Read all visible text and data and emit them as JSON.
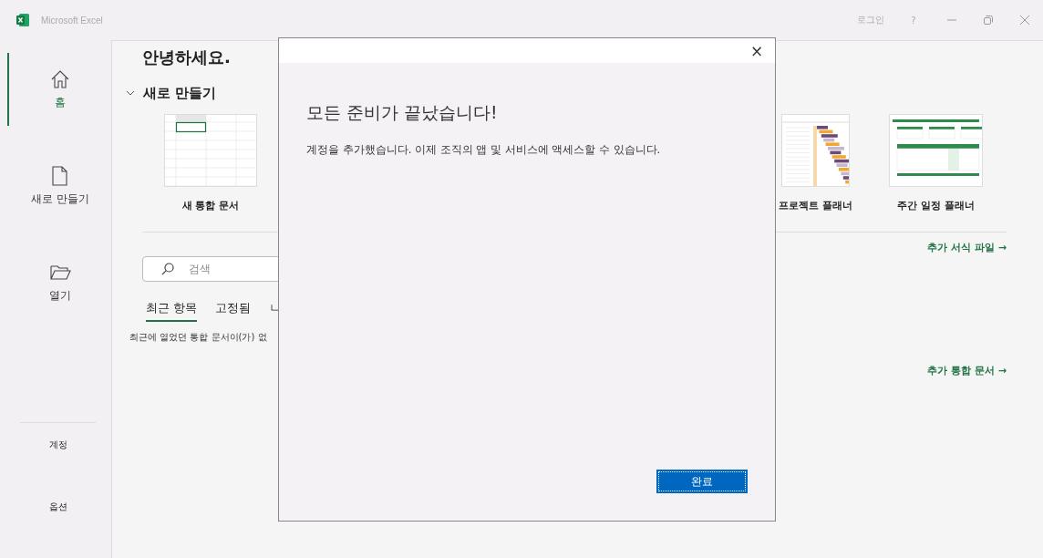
{
  "titlebar": {
    "app_name": "Microsoft Excel",
    "sign_in": "로그인",
    "help": "?"
  },
  "sidebar": {
    "items": [
      {
        "label": "홈",
        "kind": "home",
        "selected": true
      },
      {
        "label": "새로 만들기",
        "kind": "new",
        "selected": false
      },
      {
        "label": "열기",
        "kind": "open",
        "selected": false
      }
    ],
    "bottom_items": [
      "계정",
      "옵션"
    ]
  },
  "main": {
    "greeting": "안녕하세요.",
    "new_section": {
      "title": "새로 만들기",
      "expanded": true,
      "templates": [
        {
          "label": "새 통합 문서",
          "kind": "blank"
        },
        {
          "label": "프로젝트 플래너",
          "kind": "gantt"
        },
        {
          "label": "주간 일정 플래너",
          "kind": "schedule"
        }
      ],
      "more_link": "추가 서식 파일 →"
    },
    "search": {
      "placeholder": "검색"
    },
    "tabs": [
      {
        "label": "최근 항목",
        "selected": true
      },
      {
        "label": "고정됨",
        "selected": false
      },
      {
        "label": "ㄴ",
        "selected": false
      }
    ],
    "empty_message": "최근에 열었던 통합 문서이(가) 없",
    "more_workbooks_link": "추가 통합 문서 →"
  },
  "dialog": {
    "close": "×",
    "heading": "모든 준비가 끝났습니다!",
    "message": "계정을 추가했습니다. 이제 조직의 앱 및 서비스에 액세스할 수 있습니다.",
    "button": "완료"
  }
}
